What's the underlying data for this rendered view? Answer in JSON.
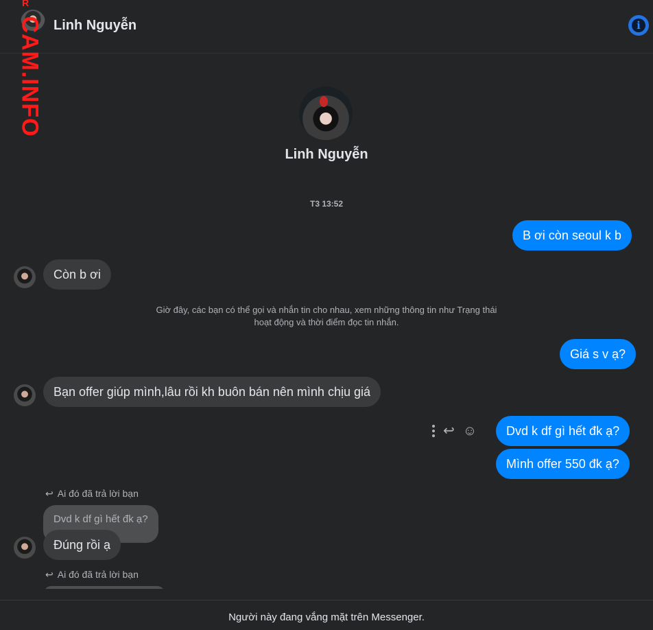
{
  "header": {
    "contact_name": "Linh Nguyễn",
    "info_icon": "info-icon"
  },
  "watermark": {
    "small": "R",
    "text": "CAM.INFO"
  },
  "profile": {
    "name": "Linh Nguyễn"
  },
  "conversation": {
    "timestamp": "T3 13:52",
    "messages": [
      {
        "direction": "out",
        "text": "B ơi còn seoul k b"
      },
      {
        "direction": "in",
        "text": "Còn b ơi"
      },
      {
        "direction": "notice",
        "text": "Giờ đây, các bạn có thể gọi và nhắn tin cho nhau, xem những thông tin như Trạng thái hoạt động và thời điểm đọc tin nhắn."
      },
      {
        "direction": "out",
        "text": "Giá s v ạ?"
      },
      {
        "direction": "in",
        "text": "Bạn offer giúp mình,lâu rồi kh buôn bán nên mình chịu giá"
      },
      {
        "direction": "out",
        "text": "Dvd k df gì hết đk ạ?"
      },
      {
        "direction": "out",
        "text": "Mình offer 550 đk ạ?"
      },
      {
        "direction": "in",
        "text": "Đúng rồi ạ",
        "reply_hint": "Ai đó đã trả lời bạn",
        "quoted": "Dvd k df gì hết đk ạ?"
      }
    ],
    "trailing_reply_hint": "Ai đó đã trả lời bạn"
  },
  "message_actions": {
    "more_icon": "more-vertical-icon",
    "reply_icon": "reply-icon",
    "react_icon": "smiley-icon"
  },
  "footer": {
    "status_text": "Người này đang vắng mặt trên Messenger."
  },
  "colors": {
    "background": "#242526",
    "outgoing_bubble": "#0084ff",
    "incoming_bubble": "#3a3b3c",
    "accent": "#2374e1"
  }
}
